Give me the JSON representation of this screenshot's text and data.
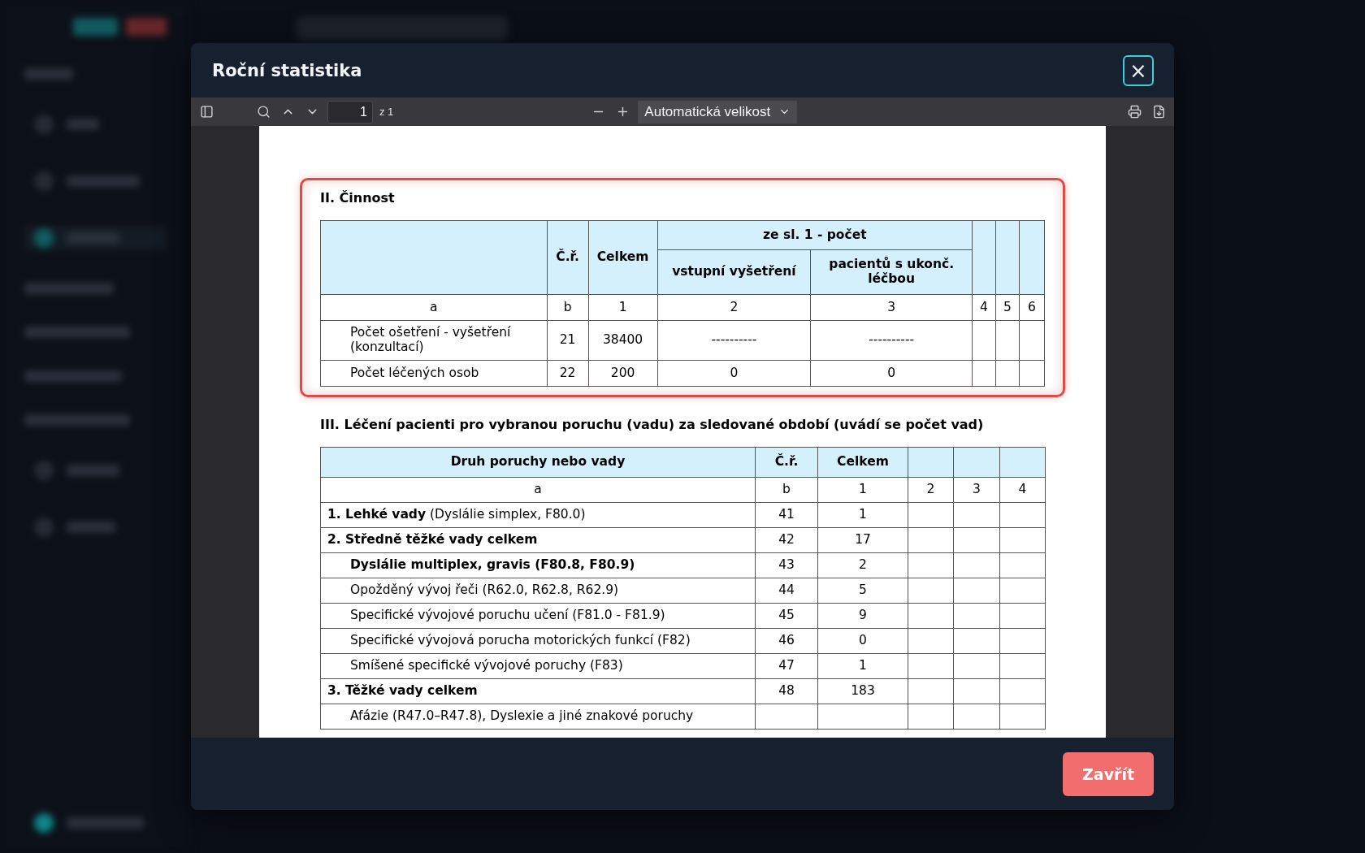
{
  "modal": {
    "title": "Roční statistika",
    "close_button": "×"
  },
  "pdf_toolbar": {
    "page_value": "1",
    "page_count": "z 1",
    "zoom_label": "Automatická velikost"
  },
  "activity": {
    "title": "II. Činnost",
    "highlighted": true,
    "header": {
      "col_2": "Č.ř.",
      "col_3": "Celkem",
      "group": "ze sl. 1 - počet",
      "subcolumns": [
        "vstupní vyšetření",
        "pacientů s ukonč. léčbou"
      ]
    },
    "index_row": [
      "a",
      "b",
      "1",
      "2",
      "3",
      "4",
      "5",
      "6"
    ],
    "rows": [
      {
        "cells": [
          "Počet ošetření - vyšetření (konzultací)",
          "21",
          "38400",
          "----------",
          "----------"
        ]
      },
      {
        "cells": [
          "Počet léčených osob",
          "22",
          "200",
          "0",
          "0"
        ]
      }
    ]
  },
  "treatment": {
    "title": "III. Léčení pacienti pro vybranou poruchu (vadu) za sledované období (uvádí se počet vad)",
    "header": [
      "Druh poruchy nebo vady",
      "Č.ř.",
      "Celkem"
    ],
    "index_row": [
      "a",
      "b",
      "1",
      "2",
      "3",
      "4"
    ],
    "rows": [
      {
        "label": "**1. Lehké vady** (Dyslálie simplex, F80.0)",
        "bold": false,
        "indented": false,
        "number": "41",
        "total": "1"
      },
      {
        "label": "2. Středně těžké vady celkem",
        "bold": true,
        "indented": false,
        "number": "42",
        "total": "17"
      },
      {
        "label": "Dyslálie multiplex, gravis (F80.8, F80.9)",
        "bold": true,
        "indented": true,
        "number": "43",
        "total": "2"
      },
      {
        "label": "Opožděný vývoj řeči (R62.0, R62.8, R62.9)",
        "bold": false,
        "indented": true,
        "number": "44",
        "total": "5"
      },
      {
        "label": "Specifické vývojové poruchu učení (F81.0 - F81.9)",
        "bold": false,
        "indented": true,
        "number": "45",
        "total": "9"
      },
      {
        "label": "Specifické vývojová porucha motorických funkcí (F82)",
        "bold": false,
        "indented": true,
        "number": "46",
        "total": "0"
      },
      {
        "label": "Smíšené specifické vývojové poruchy (F83)",
        "bold": false,
        "indented": true,
        "number": "47",
        "total": "1"
      },
      {
        "label": "3. Těžké vady celkem",
        "bold": true,
        "indented": false,
        "number": "48",
        "total": "183"
      },
      {
        "label": "Afázie (R47.0–R47.8), Dyslexie a jiné znakové poruchy",
        "bold": false,
        "indented": true
      }
    ]
  },
  "footer": {
    "close_label": "Zavřít"
  }
}
